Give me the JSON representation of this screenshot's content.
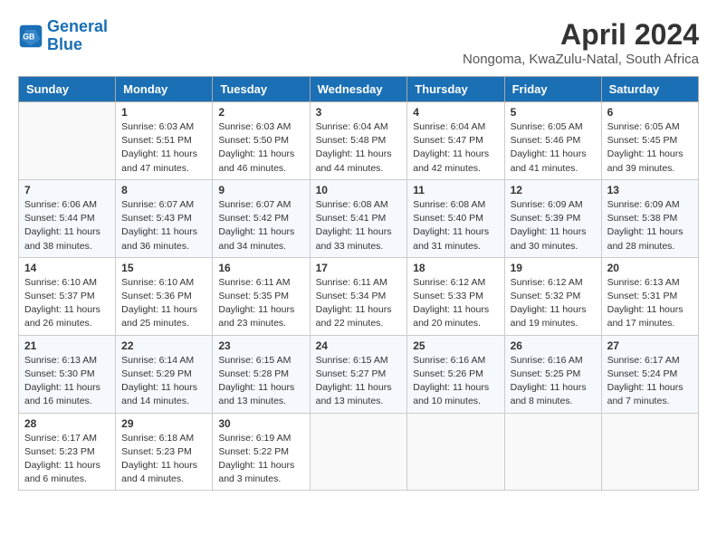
{
  "header": {
    "logo_line1": "General",
    "logo_line2": "Blue",
    "title": "April 2024",
    "subtitle": "Nongoma, KwaZulu-Natal, South Africa"
  },
  "weekdays": [
    "Sunday",
    "Monday",
    "Tuesday",
    "Wednesday",
    "Thursday",
    "Friday",
    "Saturday"
  ],
  "weeks": [
    [
      {
        "day": "",
        "text": ""
      },
      {
        "day": "1",
        "text": "Sunrise: 6:03 AM\nSunset: 5:51 PM\nDaylight: 11 hours\nand 47 minutes."
      },
      {
        "day": "2",
        "text": "Sunrise: 6:03 AM\nSunset: 5:50 PM\nDaylight: 11 hours\nand 46 minutes."
      },
      {
        "day": "3",
        "text": "Sunrise: 6:04 AM\nSunset: 5:48 PM\nDaylight: 11 hours\nand 44 minutes."
      },
      {
        "day": "4",
        "text": "Sunrise: 6:04 AM\nSunset: 5:47 PM\nDaylight: 11 hours\nand 42 minutes."
      },
      {
        "day": "5",
        "text": "Sunrise: 6:05 AM\nSunset: 5:46 PM\nDaylight: 11 hours\nand 41 minutes."
      },
      {
        "day": "6",
        "text": "Sunrise: 6:05 AM\nSunset: 5:45 PM\nDaylight: 11 hours\nand 39 minutes."
      }
    ],
    [
      {
        "day": "7",
        "text": "Sunrise: 6:06 AM\nSunset: 5:44 PM\nDaylight: 11 hours\nand 38 minutes."
      },
      {
        "day": "8",
        "text": "Sunrise: 6:07 AM\nSunset: 5:43 PM\nDaylight: 11 hours\nand 36 minutes."
      },
      {
        "day": "9",
        "text": "Sunrise: 6:07 AM\nSunset: 5:42 PM\nDaylight: 11 hours\nand 34 minutes."
      },
      {
        "day": "10",
        "text": "Sunrise: 6:08 AM\nSunset: 5:41 PM\nDaylight: 11 hours\nand 33 minutes."
      },
      {
        "day": "11",
        "text": "Sunrise: 6:08 AM\nSunset: 5:40 PM\nDaylight: 11 hours\nand 31 minutes."
      },
      {
        "day": "12",
        "text": "Sunrise: 6:09 AM\nSunset: 5:39 PM\nDaylight: 11 hours\nand 30 minutes."
      },
      {
        "day": "13",
        "text": "Sunrise: 6:09 AM\nSunset: 5:38 PM\nDaylight: 11 hours\nand 28 minutes."
      }
    ],
    [
      {
        "day": "14",
        "text": "Sunrise: 6:10 AM\nSunset: 5:37 PM\nDaylight: 11 hours\nand 26 minutes."
      },
      {
        "day": "15",
        "text": "Sunrise: 6:10 AM\nSunset: 5:36 PM\nDaylight: 11 hours\nand 25 minutes."
      },
      {
        "day": "16",
        "text": "Sunrise: 6:11 AM\nSunset: 5:35 PM\nDaylight: 11 hours\nand 23 minutes."
      },
      {
        "day": "17",
        "text": "Sunrise: 6:11 AM\nSunset: 5:34 PM\nDaylight: 11 hours\nand 22 minutes."
      },
      {
        "day": "18",
        "text": "Sunrise: 6:12 AM\nSunset: 5:33 PM\nDaylight: 11 hours\nand 20 minutes."
      },
      {
        "day": "19",
        "text": "Sunrise: 6:12 AM\nSunset: 5:32 PM\nDaylight: 11 hours\nand 19 minutes."
      },
      {
        "day": "20",
        "text": "Sunrise: 6:13 AM\nSunset: 5:31 PM\nDaylight: 11 hours\nand 17 minutes."
      }
    ],
    [
      {
        "day": "21",
        "text": "Sunrise: 6:13 AM\nSunset: 5:30 PM\nDaylight: 11 hours\nand 16 minutes."
      },
      {
        "day": "22",
        "text": "Sunrise: 6:14 AM\nSunset: 5:29 PM\nDaylight: 11 hours\nand 14 minutes."
      },
      {
        "day": "23",
        "text": "Sunrise: 6:15 AM\nSunset: 5:28 PM\nDaylight: 11 hours\nand 13 minutes."
      },
      {
        "day": "24",
        "text": "Sunrise: 6:15 AM\nSunset: 5:27 PM\nDaylight: 11 hours\nand 13 minutes."
      },
      {
        "day": "25",
        "text": "Sunrise: 6:16 AM\nSunset: 5:26 PM\nDaylight: 11 hours\nand 10 minutes."
      },
      {
        "day": "26",
        "text": "Sunrise: 6:16 AM\nSunset: 5:25 PM\nDaylight: 11 hours\nand 8 minutes."
      },
      {
        "day": "27",
        "text": "Sunrise: 6:17 AM\nSunset: 5:24 PM\nDaylight: 11 hours\nand 7 minutes."
      }
    ],
    [
      {
        "day": "28",
        "text": "Sunrise: 6:17 AM\nSunset: 5:23 PM\nDaylight: 11 hours\nand 6 minutes."
      },
      {
        "day": "29",
        "text": "Sunrise: 6:18 AM\nSunset: 5:23 PM\nDaylight: 11 hours\nand 4 minutes."
      },
      {
        "day": "30",
        "text": "Sunrise: 6:19 AM\nSunset: 5:22 PM\nDaylight: 11 hours\nand 3 minutes."
      },
      {
        "day": "",
        "text": ""
      },
      {
        "day": "",
        "text": ""
      },
      {
        "day": "",
        "text": ""
      },
      {
        "day": "",
        "text": ""
      }
    ]
  ]
}
